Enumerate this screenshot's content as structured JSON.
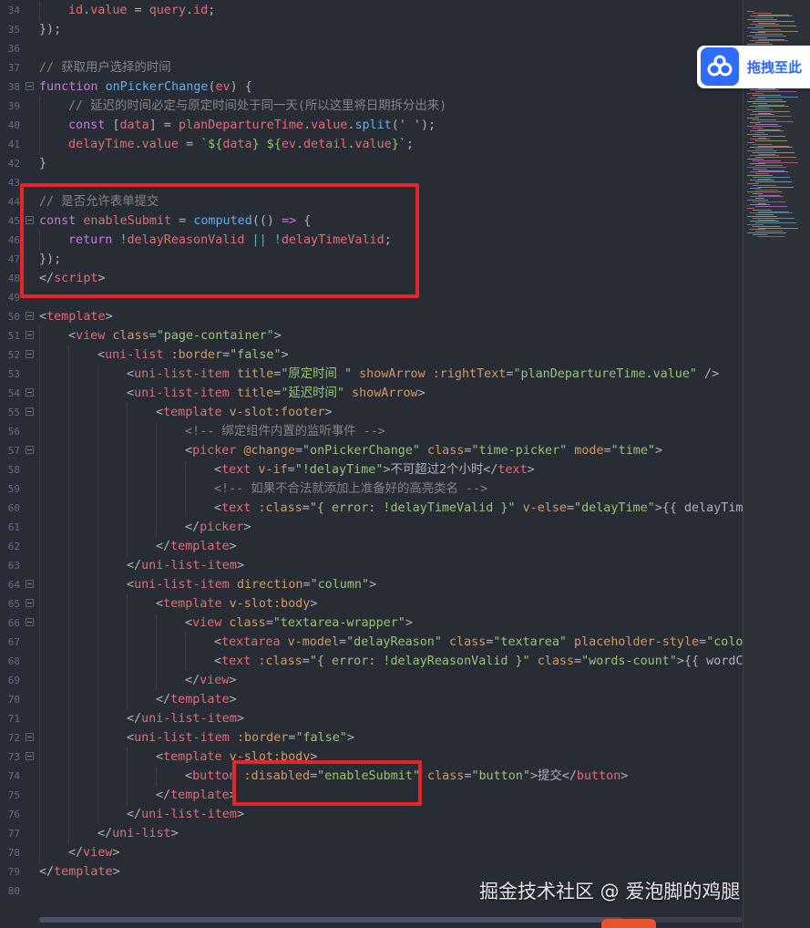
{
  "tab_bar": {
    "title": ""
  },
  "lines": [
    {
      "n": "34",
      "fold": false,
      "indent": 1,
      "toks": [
        [
          "id",
          "v"
        ],
        [
          ".",
          "p"
        ],
        [
          "value",
          "v"
        ],
        [
          " = ",
          "p"
        ],
        [
          "query",
          "v"
        ],
        [
          ".",
          "p"
        ],
        [
          "id",
          "v"
        ],
        [
          ";",
          "p"
        ]
      ]
    },
    {
      "n": "35",
      "fold": false,
      "indent": 0,
      "toks": [
        [
          "});",
          "p"
        ]
      ]
    },
    {
      "n": "36",
      "fold": false,
      "indent": 0,
      "toks": []
    },
    {
      "n": "37",
      "fold": false,
      "indent": 0,
      "toks": [
        [
          "// 获取用户选择的时间",
          "c"
        ]
      ]
    },
    {
      "n": "38",
      "fold": true,
      "indent": 0,
      "toks": [
        [
          "function ",
          "k"
        ],
        [
          "onPickerChange",
          "f"
        ],
        [
          "(",
          "p"
        ],
        [
          "ev",
          "v"
        ],
        [
          ") {",
          "p"
        ]
      ]
    },
    {
      "n": "39",
      "fold": false,
      "indent": 1,
      "toks": [
        [
          "// 延迟的时间必定与原定时间处于同一天(所以这里将日期拆分出来)",
          "c"
        ]
      ]
    },
    {
      "n": "40",
      "fold": false,
      "indent": 1,
      "toks": [
        [
          "const ",
          "k"
        ],
        [
          "[",
          "p"
        ],
        [
          "data",
          "v"
        ],
        [
          "] = ",
          "p"
        ],
        [
          "planDepartureTime",
          "v"
        ],
        [
          ".",
          "p"
        ],
        [
          "value",
          "v"
        ],
        [
          ".",
          "p"
        ],
        [
          "split",
          "f"
        ],
        [
          "(",
          "p"
        ],
        [
          "' '",
          "s"
        ],
        [
          ");",
          "p"
        ]
      ]
    },
    {
      "n": "41",
      "fold": false,
      "indent": 1,
      "toks": [
        [
          "delayTime",
          "v"
        ],
        [
          ".",
          "p"
        ],
        [
          "value",
          "v"
        ],
        [
          " = ",
          "p"
        ],
        [
          "`${",
          "s"
        ],
        [
          "data",
          "v"
        ],
        [
          "} ${",
          "s"
        ],
        [
          "ev",
          "v"
        ],
        [
          ".",
          "p"
        ],
        [
          "detail",
          "v"
        ],
        [
          ".",
          "p"
        ],
        [
          "value",
          "v"
        ],
        [
          "}`",
          "s"
        ],
        [
          ";",
          "p"
        ]
      ]
    },
    {
      "n": "42",
      "fold": false,
      "indent": 0,
      "toks": [
        [
          "}",
          "p"
        ]
      ]
    },
    {
      "n": "43",
      "fold": false,
      "indent": 0,
      "toks": []
    },
    {
      "n": "44",
      "fold": false,
      "indent": 0,
      "toks": [
        [
          "// 是否允许表单提交",
          "c"
        ]
      ]
    },
    {
      "n": "45",
      "fold": true,
      "indent": 0,
      "toks": [
        [
          "const ",
          "k"
        ],
        [
          "enableSubmit",
          "v"
        ],
        [
          " = ",
          "p"
        ],
        [
          "computed",
          "f"
        ],
        [
          "(() ",
          "p"
        ],
        [
          "=>",
          "k"
        ],
        [
          " {",
          "p"
        ]
      ]
    },
    {
      "n": "46",
      "fold": false,
      "indent": 1,
      "toks": [
        [
          "return ",
          "k"
        ],
        [
          "!",
          "o"
        ],
        [
          "delayReasonValid",
          "v"
        ],
        [
          " || ",
          "o"
        ],
        [
          "!",
          "o"
        ],
        [
          "delayTimeValid",
          "v"
        ],
        [
          ";",
          "p"
        ]
      ]
    },
    {
      "n": "47",
      "fold": false,
      "indent": 0,
      "toks": [
        [
          "});",
          "p"
        ]
      ]
    },
    {
      "n": "48",
      "fold": false,
      "indent": 0,
      "toks": [
        [
          "</",
          "p"
        ],
        [
          "script",
          "v"
        ],
        [
          ">",
          "p"
        ]
      ]
    },
    {
      "n": "49",
      "fold": false,
      "indent": 0,
      "toks": []
    },
    {
      "n": "50",
      "fold": true,
      "indent": 0,
      "toks": [
        [
          "<",
          "p"
        ],
        [
          "template",
          "v"
        ],
        [
          ">",
          "p"
        ]
      ]
    },
    {
      "n": "51",
      "fold": true,
      "indent": 1,
      "toks": [
        [
          "<",
          "p"
        ],
        [
          "view ",
          "v"
        ],
        [
          "class",
          "a"
        ],
        [
          "=",
          "p"
        ],
        [
          "\"page-container\"",
          "s"
        ],
        [
          ">",
          "p"
        ]
      ]
    },
    {
      "n": "52",
      "fold": true,
      "indent": 2,
      "toks": [
        [
          "<",
          "p"
        ],
        [
          "uni-list ",
          "v"
        ],
        [
          ":border",
          "a"
        ],
        [
          "=",
          "p"
        ],
        [
          "\"false\"",
          "s"
        ],
        [
          ">",
          "p"
        ]
      ]
    },
    {
      "n": "53",
      "fold": false,
      "indent": 3,
      "toks": [
        [
          "<",
          "p"
        ],
        [
          "uni-list-item ",
          "v"
        ],
        [
          "title",
          "a"
        ],
        [
          "=",
          "p"
        ],
        [
          "\"原定时间 \"",
          "s"
        ],
        [
          " showArrow ",
          "a"
        ],
        [
          ":rightText",
          "a"
        ],
        [
          "=",
          "p"
        ],
        [
          "\"planDepartureTime.value\"",
          "s"
        ],
        [
          " />",
          "p"
        ]
      ]
    },
    {
      "n": "54",
      "fold": true,
      "indent": 3,
      "toks": [
        [
          "<",
          "p"
        ],
        [
          "uni-list-item ",
          "v"
        ],
        [
          "title",
          "a"
        ],
        [
          "=",
          "p"
        ],
        [
          "\"延迟时间\"",
          "s"
        ],
        [
          " showArrow",
          "a"
        ],
        [
          ">",
          "p"
        ]
      ]
    },
    {
      "n": "55",
      "fold": true,
      "indent": 4,
      "toks": [
        [
          "<",
          "p"
        ],
        [
          "template ",
          "v"
        ],
        [
          "v-slot:footer",
          "a"
        ],
        [
          ">",
          "p"
        ]
      ]
    },
    {
      "n": "56",
      "fold": false,
      "indent": 5,
      "toks": [
        [
          "<!-- 绑定组件内置的监听事件 -->",
          "c"
        ]
      ]
    },
    {
      "n": "57",
      "fold": true,
      "indent": 5,
      "toks": [
        [
          "<",
          "p"
        ],
        [
          "picker ",
          "v"
        ],
        [
          "@change",
          "a"
        ],
        [
          "=",
          "p"
        ],
        [
          "\"onPickerChange\"",
          "s"
        ],
        [
          " class",
          "a"
        ],
        [
          "=",
          "p"
        ],
        [
          "\"time-picker\"",
          "s"
        ],
        [
          " mode",
          "a"
        ],
        [
          "=",
          "p"
        ],
        [
          "\"time\"",
          "s"
        ],
        [
          ">",
          "p"
        ]
      ]
    },
    {
      "n": "58",
      "fold": false,
      "indent": 6,
      "toks": [
        [
          "<",
          "p"
        ],
        [
          "text ",
          "v"
        ],
        [
          "v-if",
          "a"
        ],
        [
          "=",
          "p"
        ],
        [
          "\"!delayTime\"",
          "s"
        ],
        [
          ">不可超过2个小时</",
          "p"
        ],
        [
          "text",
          "v"
        ],
        [
          ">",
          "p"
        ]
      ]
    },
    {
      "n": "59",
      "fold": false,
      "indent": 6,
      "toks": [
        [
          "<!-- 如果不合法就添加上准备好的高亮类名 -->",
          "c"
        ]
      ]
    },
    {
      "n": "60",
      "fold": false,
      "indent": 6,
      "toks": [
        [
          "<",
          "p"
        ],
        [
          "text ",
          "v"
        ],
        [
          ":class",
          "a"
        ],
        [
          "=",
          "p"
        ],
        [
          "\"{ error: !delayTimeValid }\"",
          "s"
        ],
        [
          " v-else",
          "a"
        ],
        [
          "=",
          "p"
        ],
        [
          "\"delayTime\"",
          "s"
        ],
        [
          ">{{ delayTime",
          "p"
        ]
      ]
    },
    {
      "n": "61",
      "fold": false,
      "indent": 5,
      "toks": [
        [
          "</",
          "p"
        ],
        [
          "picker",
          "v"
        ],
        [
          ">",
          "p"
        ]
      ]
    },
    {
      "n": "62",
      "fold": false,
      "indent": 4,
      "toks": [
        [
          "</",
          "p"
        ],
        [
          "template",
          "v"
        ],
        [
          ">",
          "p"
        ]
      ]
    },
    {
      "n": "63",
      "fold": false,
      "indent": 3,
      "toks": [
        [
          "</",
          "p"
        ],
        [
          "uni-list-item",
          "v"
        ],
        [
          ">",
          "p"
        ]
      ]
    },
    {
      "n": "64",
      "fold": true,
      "indent": 3,
      "toks": [
        [
          "<",
          "p"
        ],
        [
          "uni-list-item ",
          "v"
        ],
        [
          "direction",
          "a"
        ],
        [
          "=",
          "p"
        ],
        [
          "\"column\"",
          "s"
        ],
        [
          ">",
          "p"
        ]
      ]
    },
    {
      "n": "65",
      "fold": true,
      "indent": 4,
      "toks": [
        [
          "<",
          "p"
        ],
        [
          "template ",
          "v"
        ],
        [
          "v-slot:body",
          "a"
        ],
        [
          ">",
          "p"
        ]
      ]
    },
    {
      "n": "66",
      "fold": true,
      "indent": 5,
      "toks": [
        [
          "<",
          "p"
        ],
        [
          "view ",
          "v"
        ],
        [
          "class",
          "a"
        ],
        [
          "=",
          "p"
        ],
        [
          "\"textarea-wrapper\"",
          "s"
        ],
        [
          ">",
          "p"
        ]
      ]
    },
    {
      "n": "67",
      "fold": false,
      "indent": 6,
      "toks": [
        [
          "<",
          "p"
        ],
        [
          "textarea ",
          "v"
        ],
        [
          "v-model",
          "a"
        ],
        [
          "=",
          "p"
        ],
        [
          "\"delayReason\"",
          "s"
        ],
        [
          " class",
          "a"
        ],
        [
          "=",
          "p"
        ],
        [
          "\"textarea\"",
          "s"
        ],
        [
          " placeholder-style",
          "a"
        ],
        [
          "=",
          "p"
        ],
        [
          "\"color",
          "s"
        ]
      ]
    },
    {
      "n": "68",
      "fold": false,
      "indent": 6,
      "toks": [
        [
          "<",
          "p"
        ],
        [
          "text ",
          "v"
        ],
        [
          ":class",
          "a"
        ],
        [
          "=",
          "p"
        ],
        [
          "\"{ error: !delayReasonValid }\"",
          "s"
        ],
        [
          " class",
          "a"
        ],
        [
          "=",
          "p"
        ],
        [
          "\"words-count\"",
          "s"
        ],
        [
          ">{{ wordCo",
          "p"
        ]
      ]
    },
    {
      "n": "69",
      "fold": false,
      "indent": 5,
      "toks": [
        [
          "</",
          "p"
        ],
        [
          "view",
          "v"
        ],
        [
          ">",
          "p"
        ]
      ]
    },
    {
      "n": "70",
      "fold": false,
      "indent": 4,
      "toks": [
        [
          "</",
          "p"
        ],
        [
          "template",
          "v"
        ],
        [
          ">",
          "p"
        ]
      ]
    },
    {
      "n": "71",
      "fold": false,
      "indent": 3,
      "toks": [
        [
          "</",
          "p"
        ],
        [
          "uni-list-item",
          "v"
        ],
        [
          ">",
          "p"
        ]
      ]
    },
    {
      "n": "72",
      "fold": true,
      "indent": 3,
      "toks": [
        [
          "<",
          "p"
        ],
        [
          "uni-list-item ",
          "v"
        ],
        [
          ":border",
          "a"
        ],
        [
          "=",
          "p"
        ],
        [
          "\"false\"",
          "s"
        ],
        [
          ">",
          "p"
        ]
      ]
    },
    {
      "n": "73",
      "fold": true,
      "indent": 4,
      "toks": [
        [
          "<",
          "p"
        ],
        [
          "template ",
          "v"
        ],
        [
          "v-slot:body",
          "a"
        ],
        [
          ">",
          "p"
        ]
      ]
    },
    {
      "n": "74",
      "fold": false,
      "indent": 5,
      "toks": [
        [
          "<",
          "p"
        ],
        [
          "button ",
          "v"
        ],
        [
          ":disabled",
          "a"
        ],
        [
          "=",
          "p"
        ],
        [
          "\"enableSubmit\"",
          "s"
        ],
        [
          " class",
          "a"
        ],
        [
          "=",
          "p"
        ],
        [
          "\"button\"",
          "s"
        ],
        [
          ">提交</",
          "p"
        ],
        [
          "button",
          "v"
        ],
        [
          ">",
          "p"
        ]
      ]
    },
    {
      "n": "75",
      "fold": false,
      "indent": 4,
      "toks": [
        [
          "</",
          "p"
        ],
        [
          "template",
          "v"
        ],
        [
          ">",
          "p"
        ]
      ]
    },
    {
      "n": "76",
      "fold": false,
      "indent": 3,
      "toks": [
        [
          "</",
          "p"
        ],
        [
          "uni-list-item",
          "v"
        ],
        [
          ">",
          "p"
        ]
      ]
    },
    {
      "n": "77",
      "fold": false,
      "indent": 2,
      "toks": [
        [
          "</",
          "p"
        ],
        [
          "uni-list",
          "v"
        ],
        [
          ">",
          "p"
        ]
      ]
    },
    {
      "n": "78",
      "fold": false,
      "indent": 1,
      "toks": [
        [
          "</",
          "p"
        ],
        [
          "view",
          "v"
        ],
        [
          ">",
          "p"
        ]
      ]
    },
    {
      "n": "79",
      "fold": false,
      "indent": 0,
      "toks": [
        [
          "</",
          "p"
        ],
        [
          "template",
          "v"
        ],
        [
          ">",
          "p"
        ]
      ]
    },
    {
      "n": "80",
      "fold": false,
      "indent": 0,
      "toks": []
    }
  ],
  "overlay": {
    "baidu_label": "拖拽至此",
    "watermark": "掘金技术社区 @ 爱泡脚的鸡腿"
  },
  "colors": {
    "highlight_box": "#e8242b",
    "background": "#282c34",
    "keyword": "#c678dd",
    "function": "#61afef",
    "variable": "#e06c75",
    "string": "#98c379",
    "comment": "#7f848e",
    "attribute": "#d19a66"
  }
}
